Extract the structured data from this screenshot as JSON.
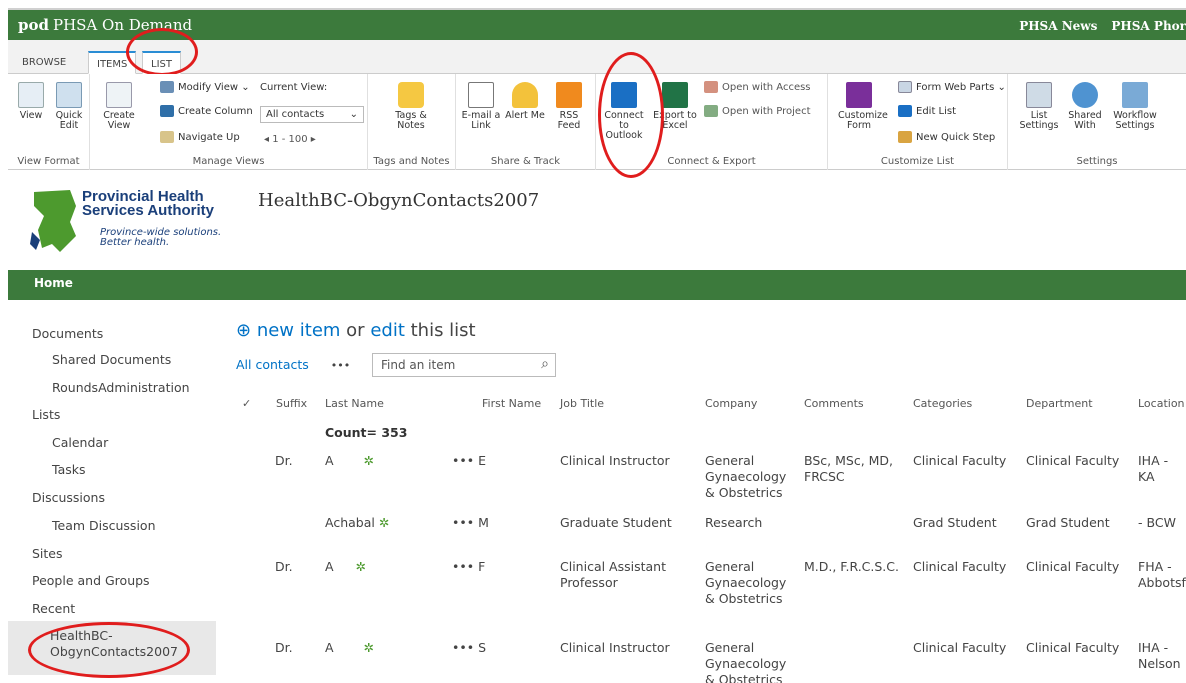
{
  "suite": {
    "brand_short": "pod",
    "brand_name": "PHSA On Demand",
    "links": [
      "PHSA News",
      "PHSA Phor"
    ]
  },
  "tabs": [
    {
      "label": "BROWSE"
    },
    {
      "label": "ITEMS"
    },
    {
      "label": "LIST"
    }
  ],
  "ribbon": {
    "view_format": {
      "label": "View Format",
      "view": "View",
      "quick_edit": "Quick Edit"
    },
    "manage_views": {
      "label": "Manage Views",
      "create_view": "Create View",
      "modify_view": "Modify View",
      "create_column": "Create Column",
      "navigate_up": "Navigate Up",
      "current_view_label": "Current View:",
      "current_view_value": "All contacts",
      "paging": "1 - 100"
    },
    "tags_notes": {
      "label": "Tags and Notes",
      "tags_notes": "Tags & Notes"
    },
    "share_track": {
      "label": "Share & Track",
      "email_link": "E-mail a Link",
      "alert_me": "Alert Me",
      "rss_feed": "RSS Feed"
    },
    "connect_export": {
      "label": "Connect & Export",
      "connect_outlook": "Connect to Outlook",
      "export_excel": "Export to Excel",
      "open_access": "Open with Access",
      "open_project": "Open with Project"
    },
    "customize_list": {
      "label": "Customize List",
      "customize_form": "Customize Form",
      "form_web_parts": "Form Web Parts",
      "edit_list": "Edit List",
      "new_quick_step": "New Quick Step"
    },
    "settings": {
      "label": "Settings",
      "list_settings": "List Settings",
      "shared_with": "Shared With",
      "workflow_settings": "Workflow Settings"
    }
  },
  "logo": {
    "line1": "Provincial Health",
    "line2": "Services Authority",
    "line3": "Province-wide solutions.",
    "line4": "Better health."
  },
  "page_title": "HealthBC-ObgynContacts2007",
  "home_label": "Home",
  "nav": [
    {
      "label": "Documents"
    },
    {
      "label": "Shared Documents"
    },
    {
      "label": "RoundsAdministration"
    },
    {
      "label": "Lists"
    },
    {
      "label": "Calendar"
    },
    {
      "label": "Tasks"
    },
    {
      "label": "Discussions"
    },
    {
      "label": "Team Discussion"
    },
    {
      "label": "Sites"
    },
    {
      "label": "People and Groups"
    },
    {
      "label": "Recent"
    },
    {
      "label": "HealthBC-\nObgynContacts2007"
    }
  ],
  "list": {
    "new_item": "new item",
    "or": "or",
    "edit": "edit",
    "this_list": "this list",
    "view_name": "All contacts",
    "more": "•••",
    "search_placeholder": "Find an item",
    "columns": [
      "Suffix",
      "Last Name",
      "First Name",
      "Job Title",
      "Company",
      "Comments",
      "Categories",
      "Department",
      "Location"
    ],
    "count_label": "Count= 353",
    "rows": [
      {
        "suffix": "Dr.",
        "last": "A",
        "first": "E",
        "job": "Clinical Instructor",
        "company": "General\nGynaecology\n& Obstetrics",
        "comments": "BSc, MSc, MD,\nFRCSC",
        "categories": "Clinical Faculty",
        "department": "Clinical Faculty",
        "location": "IHA - KA"
      },
      {
        "suffix": "",
        "last": "Achabal",
        "first": "M",
        "job": "Graduate Student",
        "company": "Research",
        "comments": "",
        "categories": "Grad Student",
        "department": "Grad Student",
        "location": "- BCW"
      },
      {
        "suffix": "Dr.",
        "last": "A",
        "first": "F",
        "job": "Clinical Assistant\nProfessor",
        "company": "General\nGynaecology\n& Obstetrics",
        "comments": "M.D., F.R.C.S.C.",
        "categories": "Clinical Faculty",
        "department": "Clinical Faculty",
        "location": "FHA -\nAbbotsf"
      },
      {
        "suffix": "Dr.",
        "last": "A",
        "first": "S",
        "job": "Clinical Instructor",
        "company": "General\nGynaecology\n& Obstetrics",
        "comments": "",
        "categories": "Clinical Faculty",
        "department": "Clinical Faculty",
        "location": "IHA -\nNelson"
      }
    ]
  }
}
